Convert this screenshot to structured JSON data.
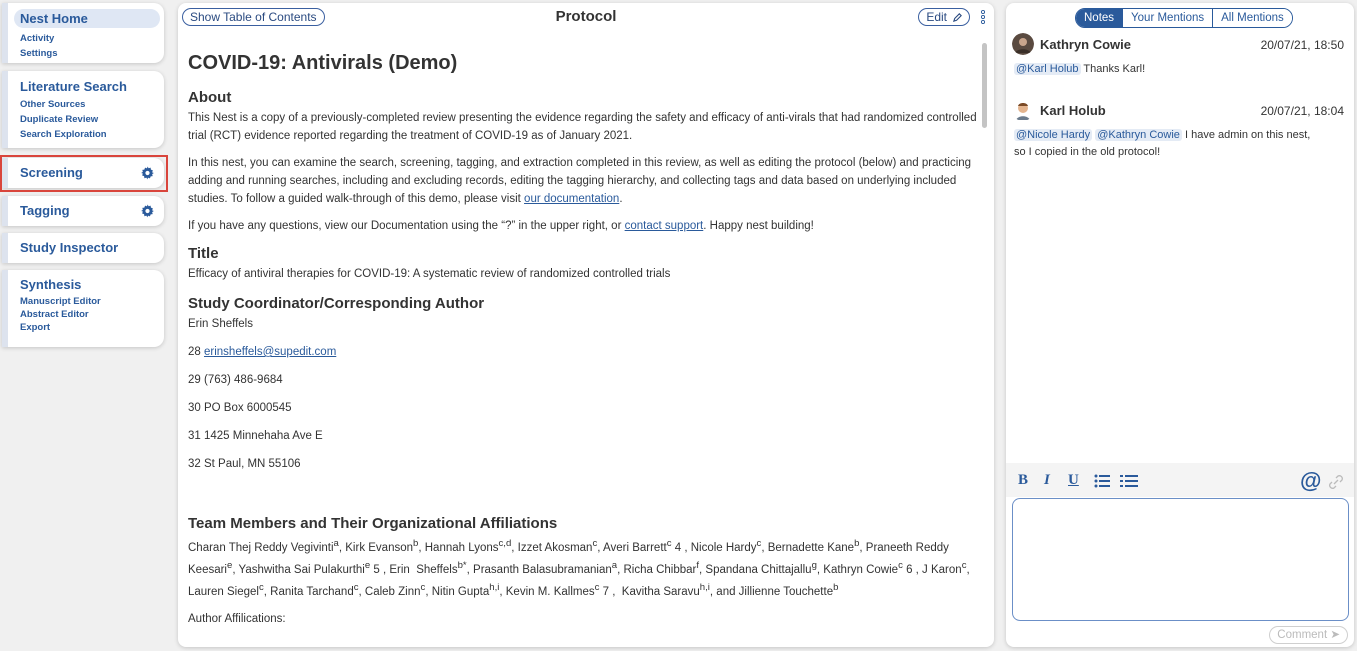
{
  "sidebar": {
    "home": {
      "title": "Nest Home",
      "items": [
        "Activity",
        "Settings"
      ]
    },
    "lit": {
      "title": "Literature Search",
      "items": [
        "Other Sources",
        "Duplicate Review",
        "Search Exploration"
      ]
    },
    "screening": "Screening",
    "tagging": "Tagging",
    "inspector": "Study Inspector",
    "synthesis": {
      "title": "Synthesis",
      "items": [
        "Manuscript Editor",
        "Abstract Editor",
        "Export"
      ]
    }
  },
  "protocol": {
    "toc_label": "Show Table of Contents",
    "title": "Protocol",
    "edit_label": "Edit",
    "doc_title": "COVID-19: Antivirals (Demo)",
    "about_heading": "About",
    "about_p1": "This Nest is a copy of a previously-completed review presenting the evidence regarding the safety and efficacy of anti-virals that had randomized controlled trial (RCT) evidence reported regarding the treatment of COVID-19 as of January 2021.",
    "about_p2": "In this nest, you can examine the search, screening, tagging, and extraction completed in this review, as well as editing the protocol (below) and practicing adding and running searches, including and excluding records, editing the tagging hierarchy, and collecting tags and data based on underlying included studies. To follow a guided walk-through of this demo, please visit",
    "about_p2_link": "our documentation",
    "about_p3_a": "If you have any questions, view our Documentation using the “?” in the upper right, or",
    "about_p3_link": "contact support",
    "about_p3_b": ". Happy nest building!",
    "title_heading": "Title",
    "title_text": "Efficacy of antiviral therapies for COVID-19: A systematic review of randomized controlled trials",
    "coord_heading": "Study Coordinator/Corresponding Author",
    "coord_name": "Erin Sheffels",
    "line28_num": "28",
    "line28_email": "erinsheffels@supedit.com",
    "line29": "29 (763) 486-9684",
    "line30": "30 PO Box 6000545",
    "line31": "31 1425 Minnehaha Ave E",
    "line32": "32 St Paul, MN 55106",
    "team_heading": "Team Members and Their Organizational Affiliations",
    "affil_label": "Author Affilications:"
  },
  "notes": {
    "tabs": [
      "Notes",
      "Your Mentions",
      "All Mentions"
    ],
    "items": [
      {
        "author": "Kathryn Cowie",
        "date": "20/07/21, 18:50",
        "mentions": [
          "@Karl Holub"
        ],
        "text": "Thanks Karl!"
      },
      {
        "author": "Karl Holub",
        "date": "20/07/21, 18:04",
        "mentions": [
          "@Nicole Hardy",
          "@Kathryn Cowie"
        ],
        "text": "I have admin on this nest,",
        "text2": "so I copied in the old protocol!"
      }
    ],
    "comment_label": "Comment"
  },
  "colors": {
    "accent": "#2a5a9b",
    "highlight_border": "#d9453c"
  }
}
